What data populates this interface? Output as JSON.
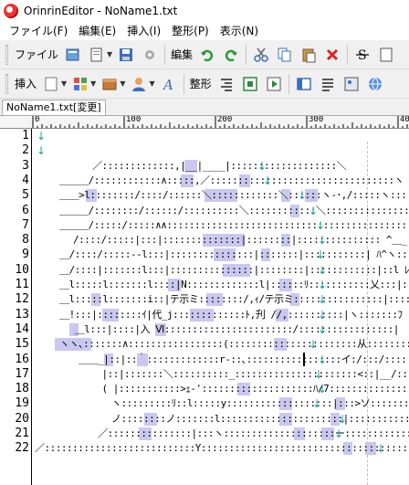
{
  "window": {
    "title": "OrinrinEditor - NoName1.txt"
  },
  "menu": [
    "ファイル(F)",
    "編集(E)",
    "挿入(I)",
    "整形(P)",
    "表示(N)"
  ],
  "toolbar1": {
    "file_label": "ファイル",
    "edit_label": "編集"
  },
  "toolbar2": {
    "insert_label": "挿入",
    "format_label": "整形"
  },
  "tab": {
    "label": "NoName1.txt[変更]"
  },
  "ruler": {
    "labels": [
      "0",
      "100",
      "200",
      "300",
      "40"
    ]
  },
  "line_numbers": [
    "1",
    "2",
    "3",
    "4",
    "5",
    "6",
    "7",
    "8",
    "9",
    "10",
    "11",
    "12",
    "13",
    "14",
    "15",
    "16",
    "17",
    "18",
    "19",
    "20",
    "21",
    "22"
  ],
  "lines": [
    "",
    "",
    "　　　　　　／:::::::::::::,|__|____|:::::::::::::::::::＼",
    "　　 ＿＿＿/::::::::::::∧:::::,／:::::::::::::::::::::::::::::::::ヽ",
    "　　 ＿＿>l::::::::/::::/::::::＼::::::::::::＼::::::ヽ-･,/:::::ヽ::::::::::｀ヽ",
    "　　 ＿＿＿/::::::::/::::::/::::::::::＼::::::::::::＼:::::::::::::::::ヽ:::::::::::::::",
    "　　 ＿＿＿/:::::/:::::∧∧::::::::::::::::::::::::::::::::::::::::::::::::::::::::::::",
    "　　　　/::::/:::::|:::|::::::::::::::|::::::::|::::::::::::::: ^＿_ヽ:::|:::::::::",
    "　　 ＿/::::/:::::--l:::|:::::::::::::::|:::::::|:::::::::::| ﾊ^ヽ::::|::::::::::",
    "　　 ＿/::::|:::::::l:::|:::::::::::::::|::::::::|::::::::::::|::l ﾚヽ::|::::::::::l",
    "　　 ＿l:::::l:::::::l::::|N:::::::::::::l|::::::ﾘ:::::::::::乂:::|:::::::::::::l",
    "　　 ＿l:::::l:::::::i::|テ示ミ::::::::/,ｨ/テ示ミ::::::::::::::::|:::::::::i",
    "　　 ＿!:::|::::::::ｲ|代_j:::::::::::::ﾄ,刋 //,::::::::::|ヽ:::::::ﾌ",
    "　　　  ＿l:::|::::|入 Ⅵ:::::::::::::::::::::::/:::::::::::::::::|",
    "　　 ヽヽ､:::::::∧:::::::::::::::::(:::::::::::::::::::::::从::::::::/::::::::",
    "　　　　 ＿＿_|::|::｀:::::::::::::r-::､:::::::::::::::::イ:/:::/:::::::::::r|",
    "　　　　　　　|::|:::::::＼::::::::::_::::::::::::::::::::::<::|__/::::::::::|",
    "　　　　　　　( |:::::::::::>ｪ-'::::::::::::::::::::ﾊ/7:::::::::::::::::::人",
    "　　　　　　　　ヽ:::::::::ﾘ::l:::::y:::::::::::::::::::|:::>ソ::::::::>:::l",
    "　　　　　　　　ノ::::::::ノ:::::::l::::::::::::::::::::::|:::::::::::::::::::::",
    "　　　　　　 ／:::::::::::::::|:::ヽ::::::::::::::::::::ー:::::::::::::::::::",
    "／:::::::::::::::::::::::::::Y::::::::::::::::::::::::::::::::::::::::ヽ:::::::::ヽ"
  ]
}
